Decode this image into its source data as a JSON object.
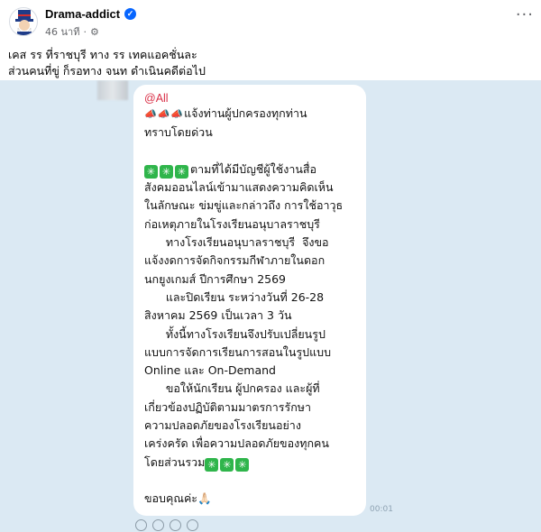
{
  "post": {
    "author": "Drama-addict",
    "time": "46 นาที",
    "caption_lines": [
      "เคส รร ที่ราชบุรี ทาง รร เทคแอคชั่นละ",
      "ส่วนคนที่ขู่ ก็รอทาง จนท ดำเนินคดีต่อไป"
    ]
  },
  "message": {
    "mention": "@All",
    "lines": [
      {
        "pre": "mega",
        "text": "แจ้งท่านผู้ปกครองทุกท่าน"
      },
      {
        "pre": "",
        "text": "ทราบโดยด่วน"
      },
      {
        "pre": "",
        "text": ""
      },
      {
        "pre": "spark",
        "text": "ตามที่ได้มีบัญชีผู้ใช้งานสื่อ"
      },
      {
        "pre": "",
        "text": "สังคมออนไลน์เข้ามาแสดงความคิดเห็น"
      },
      {
        "pre": "",
        "text": "ในลักษณะ ข่มขู่และกล่าวถึง การใช้อาวุธ"
      },
      {
        "pre": "",
        "text": "ก่อเหตุภายในโรงเรียนอนุบาลราชบุรี"
      },
      {
        "pre": "",
        "text": "      ทางโรงเรียนอนุบาลราชบุรี  จึงขอ"
      },
      {
        "pre": "",
        "text": "แจ้งงดการจัดกิจกรรมกีฬาภายในดอก"
      },
      {
        "pre": "",
        "text": "นกยูงเกมส์ ปีการศึกษา 2569"
      },
      {
        "pre": "",
        "text": "      และปิดเรียน ระหว่างวันที่ 26-28"
      },
      {
        "pre": "",
        "text": "สิงหาคม 2569 เป็นเวลา 3 วัน"
      },
      {
        "pre": "",
        "text": "      ทั้งนี้ทางโรงเรียนจึงปรับเปลี่ยนรูป"
      },
      {
        "pre": "",
        "text": "แบบการจัดการเรียนการสอนในรูปแบบ"
      },
      {
        "pre": "",
        "text": "Online และ On-Demand"
      },
      {
        "pre": "",
        "text": "      ขอให้นักเรียน ผู้ปกครอง และผู้ที่"
      },
      {
        "pre": "",
        "text": "เกี่ยวข้องปฏิบัติตามมาตรการรักษา"
      },
      {
        "pre": "",
        "text": "ความปลอดภัยของโรงเรียนอย่าง"
      },
      {
        "pre": "",
        "text": "เคร่งครัด เพื่อความปลอดภัยของทุกคน"
      },
      {
        "pre": "",
        "text": "โดยส่วนรวม",
        "post": "spark"
      },
      {
        "pre": "",
        "text": ""
      },
      {
        "pre": "",
        "text": "ขอบคุณค่ะ🙏🏻"
      }
    ],
    "time": "00:01"
  },
  "colors": {
    "chat_background": "#dbe9f3",
    "mention": "#d93047",
    "verified": "#0866ff"
  }
}
